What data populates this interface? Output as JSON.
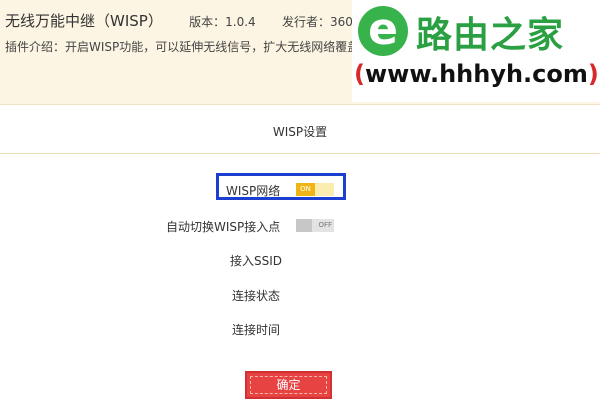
{
  "header": {
    "plugin_name": "无线万能中继（WISP）",
    "version": "版本：1.0.4",
    "publisher": "发行者：360",
    "intro": "插件介绍：开启WISP功能，可以延伸无线信号，扩大无线网络覆盖范围"
  },
  "watermark": {
    "site_cn": "路由之家",
    "url_open": "(",
    "url_text": "www.hhhyh.com",
    "url_close": ")"
  },
  "section": {
    "title": "WISP设置"
  },
  "form": {
    "wisp_network": {
      "label": "WISP网络",
      "state": "ON"
    },
    "auto_switch": {
      "label": "自动切换WISP接入点",
      "state": "OFF"
    },
    "ssid": {
      "label": "接入SSID"
    },
    "status": {
      "label": "连接状态"
    },
    "time": {
      "label": "连接时间"
    }
  },
  "actions": {
    "confirm": "确定"
  },
  "colors": {
    "accent": "#f0b515",
    "highlight": "#1d3fd1",
    "button": "#e84343"
  }
}
